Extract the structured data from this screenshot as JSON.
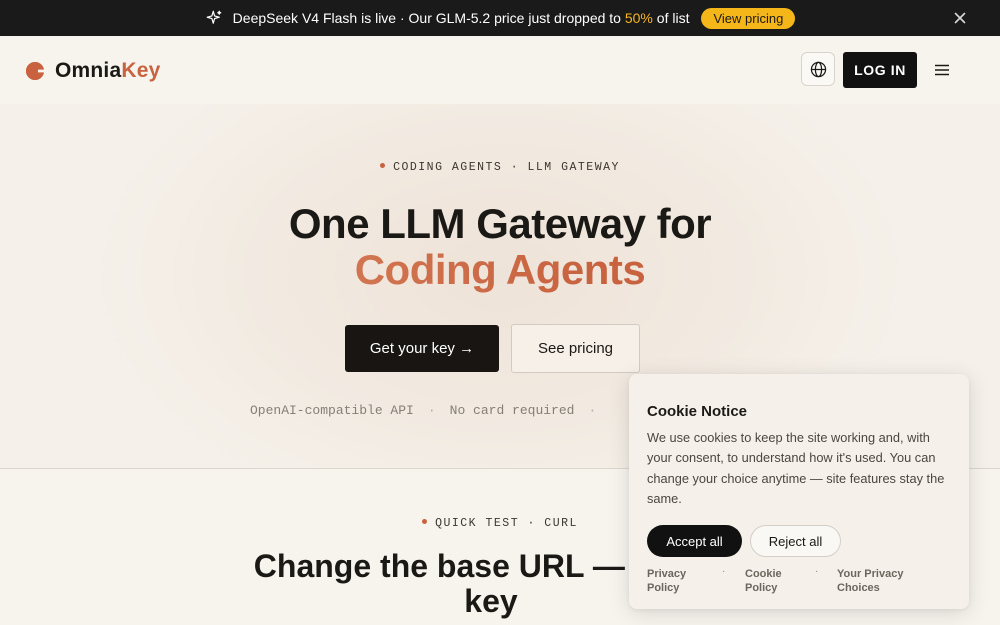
{
  "announcement": {
    "text_before": "DeepSeek V4 Flash is live · Our GLM-5.2 price just dropped to ",
    "percent": "50%",
    "text_after": " of list",
    "cta_label": "View pricing",
    "icon": "sparkle-icon",
    "close_icon": "close-icon"
  },
  "header": {
    "brand_part1": "Omnia",
    "brand_part2": "Key",
    "globe_icon": "globe-icon",
    "login_label": "LOG IN",
    "menu_icon": "hamburger-menu-icon"
  },
  "hero": {
    "eyebrow": "CODING AGENTS · LLM GATEWAY",
    "title_line1": "One LLM Gateway for",
    "title_line2": "Coding Agents",
    "primary_cta": "Get your key →",
    "secondary_cta": "See pricing",
    "features": [
      "OpenAI-compatible API",
      "No card required"
    ]
  },
  "quick_test": {
    "eyebrow": "QUICK TEST · CURL",
    "title_line1": "Change the base URL — keep t",
    "title_line2": "key"
  },
  "cookie_notice": {
    "title": "Cookie Notice",
    "body": "We use cookies to keep the site working and, with your consent, to understand how it's used. You can change your choice anytime — site features stay the same.",
    "accept_label": "Accept all",
    "reject_label": "Reject all",
    "links": [
      {
        "line1": "Privacy",
        "line2": "Policy"
      },
      {
        "line1": "Cookie",
        "line2": "Policy"
      },
      {
        "line1": "Your Privacy",
        "line2": "Choices"
      }
    ]
  },
  "colors": {
    "accent": "#c8623f",
    "announce_bg": "#1a1a1a",
    "pill_yellow": "#f5b619",
    "page_bg": "#f5f1ea"
  }
}
